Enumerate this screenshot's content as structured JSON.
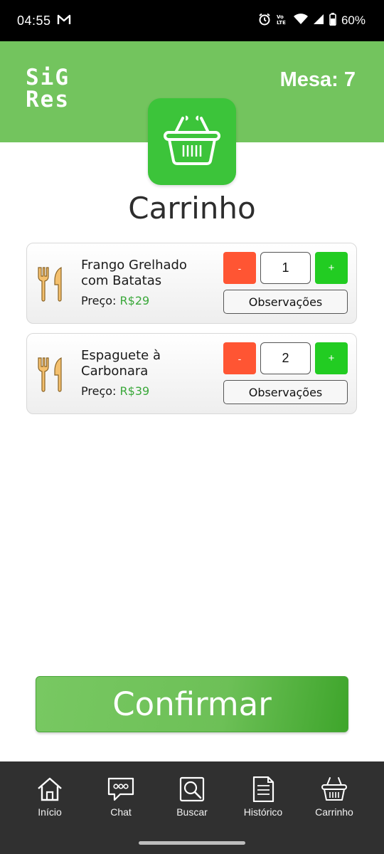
{
  "status_bar": {
    "time": "04:55",
    "battery": "60%",
    "icons": [
      "gmail-icon",
      "alarm-icon",
      "volte-icon",
      "wifi-icon",
      "signal-icon",
      "battery-icon"
    ]
  },
  "header": {
    "logo": "SiG Res",
    "logo_line1": "SiG",
    "logo_line2": "Res",
    "table": "Mesa: 7",
    "background": "#73c45e"
  },
  "page": {
    "title": "Carrinho",
    "badge_icon": "basket-icon"
  },
  "cart_items": [
    {
      "icon": "fork-knife-icon",
      "name": "Frango Grelhado com Batatas",
      "price_label": "Preço:",
      "price_value": "R$29",
      "quantity": "1",
      "minus_label": "-",
      "plus_label": "+",
      "notes_label": "Observações"
    },
    {
      "icon": "fork-knife-icon",
      "name": "Espaguete à Carbonara",
      "price_label": "Preço:",
      "price_value": "R$39",
      "quantity": "2",
      "minus_label": "-",
      "plus_label": "+",
      "notes_label": "Observações"
    }
  ],
  "confirm_label": "Confirmar",
  "nav": [
    {
      "label": "Início",
      "icon": "home-icon"
    },
    {
      "label": "Chat",
      "icon": "chat-icon"
    },
    {
      "label": "Buscar",
      "icon": "search-icon"
    },
    {
      "label": "Histórico",
      "icon": "document-icon"
    },
    {
      "label": "Carrinho",
      "icon": "basket-icon"
    }
  ],
  "colors": {
    "accent_green": "#3cc43a",
    "minus_red": "#ff5533",
    "plus_green": "#22cc22",
    "price_green": "#3aa83a",
    "nav_bg": "#303030"
  }
}
